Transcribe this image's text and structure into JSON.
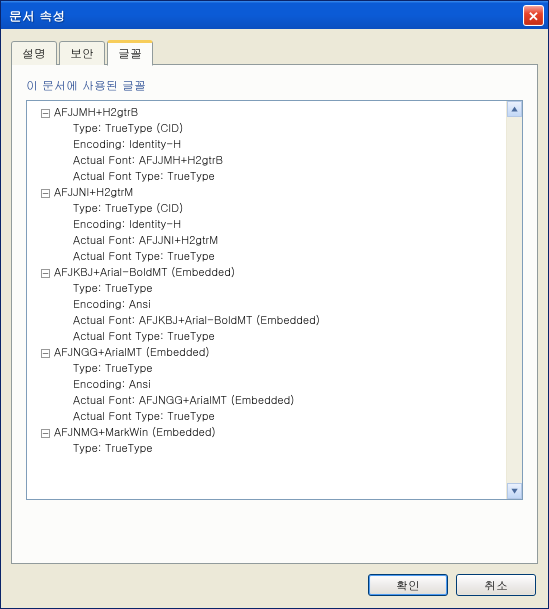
{
  "window": {
    "title": "문서 속성",
    "close_tooltip": "닫기"
  },
  "tabs": [
    {
      "label": "설명",
      "active": false
    },
    {
      "label": "보안",
      "active": false
    },
    {
      "label": "글꼴",
      "active": true
    }
  ],
  "section_title": "이 문서에 사용된 글꼴",
  "fonts": [
    {
      "name": "AFJJMH+H2gtrB",
      "details": [
        "Type: TrueType (CID)",
        "Encoding: Identity-H",
        "Actual Font: AFJJMH+H2gtrB",
        "Actual Font Type: TrueType"
      ]
    },
    {
      "name": "AFJJNI+H2gtrM",
      "details": [
        "Type: TrueType (CID)",
        "Encoding: Identity-H",
        "Actual Font: AFJJNI+H2gtrM",
        "Actual Font Type: TrueType"
      ]
    },
    {
      "name": "AFJKBJ+Arial-BoldMT (Embedded)",
      "details": [
        "Type: TrueType",
        "Encoding: Ansi",
        "Actual Font: AFJKBJ+Arial-BoldMT (Embedded)",
        "Actual Font Type: TrueType"
      ]
    },
    {
      "name": "AFJNGG+ArialMT (Embedded)",
      "details": [
        "Type: TrueType",
        "Encoding: Ansi",
        "Actual Font: AFJNGG+ArialMT (Embedded)",
        "Actual Font Type: TrueType"
      ]
    },
    {
      "name": "AFJNMG+MarkWin (Embedded)",
      "details": [
        "Type: TrueType"
      ]
    }
  ],
  "expander_glyph": "⊟",
  "scroll": {
    "up": "▲",
    "down": "▼"
  },
  "buttons": {
    "ok": "확인",
    "cancel": "취소"
  }
}
